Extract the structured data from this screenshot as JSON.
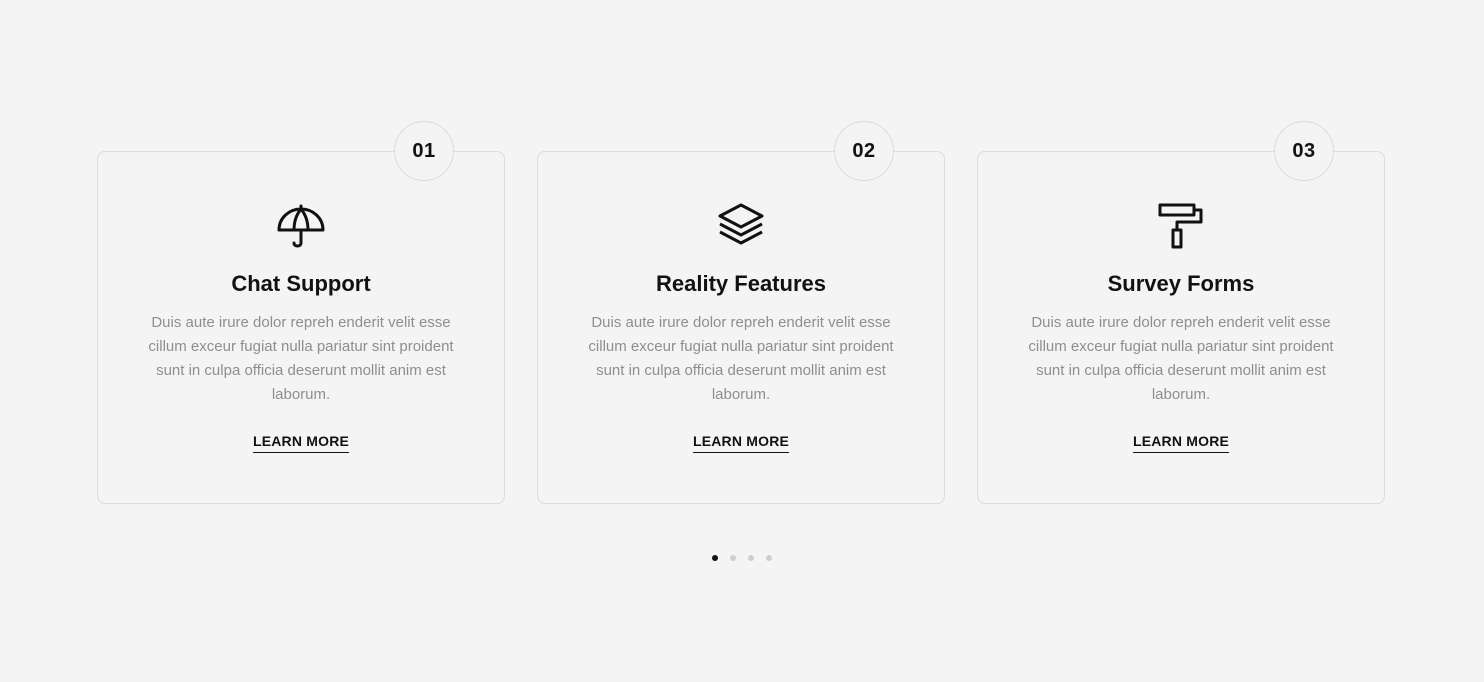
{
  "cards": [
    {
      "number": "01",
      "icon": "umbrella-icon",
      "title": "Chat Support",
      "description": "Duis aute irure dolor repreh enderit velit esse cillum exceur fugiat nulla pariatur sint proident sunt in culpa officia deserunt mollit anim est laborum.",
      "link_label": "LEARN MORE"
    },
    {
      "number": "02",
      "icon": "layers-icon",
      "title": "Reality Features",
      "description": "Duis aute irure dolor repreh enderit velit esse cillum exceur fugiat nulla pariatur sint proident sunt in culpa officia deserunt mollit anim est laborum.",
      "link_label": "LEARN MORE"
    },
    {
      "number": "03",
      "icon": "paint-roller-icon",
      "title": "Survey Forms",
      "description": "Duis aute irure dolor repreh enderit velit esse cillum exceur fugiat nulla pariatur sint proident sunt in culpa officia deserunt mollit anim est laborum.",
      "link_label": "LEARN MORE"
    }
  ],
  "pagination": {
    "total": 4,
    "active_index": 0
  },
  "colors": {
    "background": "#f4f4f4",
    "border": "#dcdcdc",
    "text": "#111111",
    "muted_text": "#8e8e8e",
    "dot_inactive": "#cfcfcf",
    "dot_active": "#111111"
  }
}
